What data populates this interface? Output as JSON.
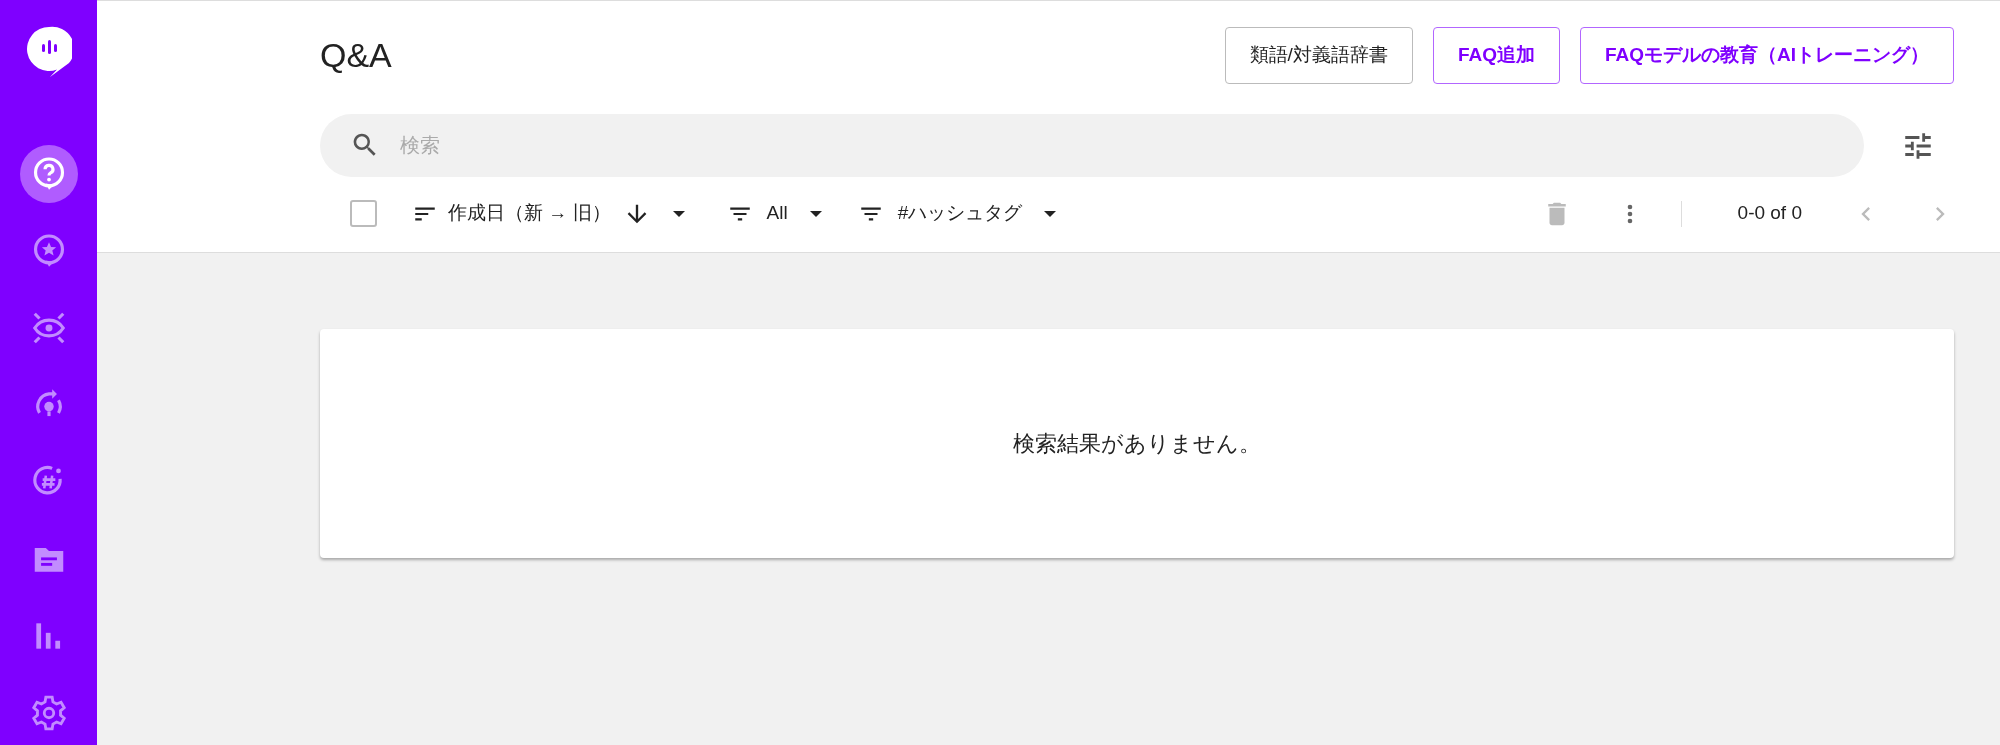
{
  "sidebar": {
    "items": [
      {
        "selected": true
      },
      {
        "selected": false
      },
      {
        "selected": false
      },
      {
        "selected": false
      },
      {
        "selected": false
      },
      {
        "selected": false
      },
      {
        "selected": false
      },
      {
        "selected": false
      }
    ]
  },
  "header": {
    "title": "Q&A",
    "buttons": [
      {
        "label": "類語/対義語辞書",
        "kind": "neutral"
      },
      {
        "label": "FAQ追加",
        "kind": "primary"
      },
      {
        "label": "FAQモデルの教育（AIトレーニング）",
        "kind": "primary"
      }
    ]
  },
  "search": {
    "placeholder": "検索"
  },
  "toolbar": {
    "select_all": {
      "checked": false
    },
    "sort": {
      "label": "作成日（新 → 旧）"
    },
    "filters": [
      {
        "label": "All"
      },
      {
        "label": "#ハッシュタグ"
      }
    ],
    "delete": {
      "disabled": true
    },
    "pager": {
      "text": "0-0 of 0",
      "prev_disabled": true,
      "next_disabled": true
    }
  },
  "results": {
    "message": "検索結果がありません。"
  }
}
